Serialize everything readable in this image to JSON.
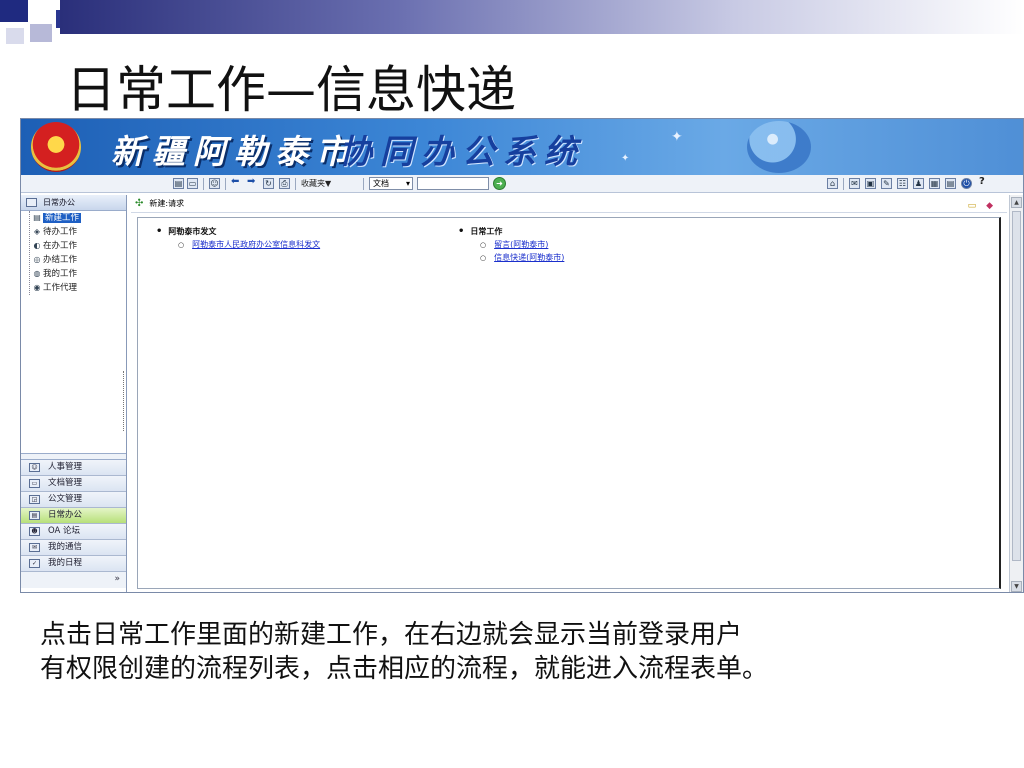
{
  "slide": {
    "title": "日常工作—信息快递",
    "caption_line1": "点击日常工作里面的新建工作，在右边就会显示当前登录用户",
    "caption_line2": "有权限创建的流程列表，点击相应的流程，就能进入流程表单。"
  },
  "banner": {
    "city_name": "新疆阿勒泰市",
    "system_name": "协同办公系统"
  },
  "toolbar": {
    "favorites_label": "收藏夹▼",
    "doc_select_value": "文档",
    "search_value": ""
  },
  "sidebar": {
    "header_label": "日常办公",
    "tree_items": [
      {
        "label": "新建工作",
        "icon": "new-work-icon",
        "selected": true
      },
      {
        "label": "待办工作",
        "icon": "pending-work-icon"
      },
      {
        "label": "在办工作",
        "icon": "in-progress-icon"
      },
      {
        "label": "办结工作",
        "icon": "finished-work-icon"
      },
      {
        "label": "我的工作",
        "icon": "my-work-icon"
      },
      {
        "label": "工作代理",
        "icon": "delegate-icon"
      }
    ],
    "modules": [
      {
        "label": "人事管理",
        "icon": "personnel-icon"
      },
      {
        "label": "文档管理",
        "icon": "document-icon"
      },
      {
        "label": "公文管理",
        "icon": "official-doc-icon"
      },
      {
        "label": "日常办公",
        "icon": "daily-office-icon",
        "active": true
      },
      {
        "label": "OA 论坛",
        "icon": "forum-icon"
      },
      {
        "label": "我的通信",
        "icon": "mail-icon"
      },
      {
        "label": "我的日程",
        "icon": "calendar-icon"
      }
    ],
    "footer_glyph": "»"
  },
  "content": {
    "breadcrumb": "新建:请求",
    "groups": [
      {
        "title": "阿勒泰市发文",
        "links": [
          "阿勒泰市人民政府办公室信息科发文"
        ]
      },
      {
        "title": "日常工作",
        "links": [
          "留言(阿勒泰市)",
          "信息快递(阿勒泰市)"
        ]
      }
    ]
  },
  "colors": {
    "banner_blue": "#1d5fb5",
    "selected_blue": "#1e5fc4",
    "active_module_green": "#b7e07a",
    "link_blue": "#1a2fcc"
  }
}
